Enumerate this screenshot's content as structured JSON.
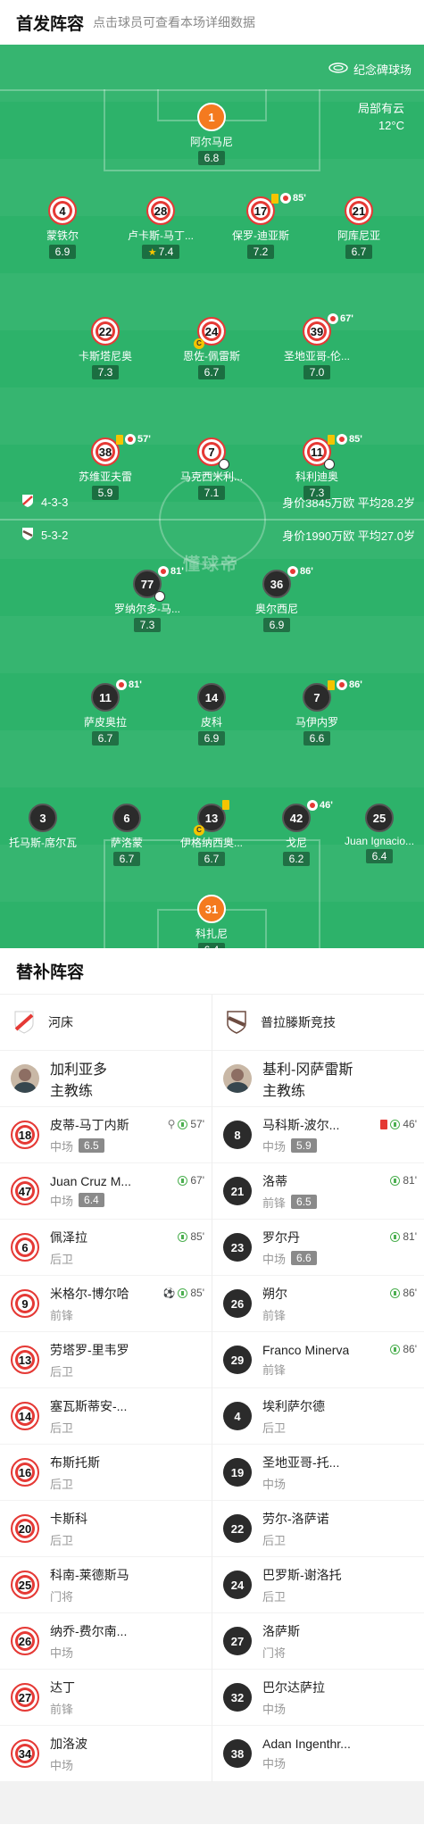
{
  "header": {
    "title": "首发阵容",
    "subtitle": "点击球员可查看本场详细数据"
  },
  "pitch": {
    "venue": "纪念碑球场",
    "weather_line1": "局部有云",
    "weather_line2": "12°C",
    "watermark": "懂球帝",
    "home_formation": "4-3-3",
    "home_value": "身价3845万欧 平均28.2岁",
    "away_formation": "5-3-2",
    "away_value": "身价1990万欧 平均27.0岁"
  },
  "home_players": [
    {
      "num": "1",
      "name": "阿尔马尼",
      "rating": "6.8",
      "gk": true
    },
    {
      "num": "4",
      "name": "蒙铁尔",
      "rating": "6.9"
    },
    {
      "num": "28",
      "name": "卢卡斯-马丁...",
      "rating": "7.4",
      "star": true
    },
    {
      "num": "17",
      "name": "保罗-迪亚斯",
      "rating": "7.2",
      "sub_min": "85'",
      "yellow": true
    },
    {
      "num": "21",
      "name": "阿库尼亚",
      "rating": "6.7"
    },
    {
      "num": "22",
      "name": "卡斯塔尼奥",
      "rating": "7.3"
    },
    {
      "num": "24",
      "name": "恩佐-佩雷斯",
      "rating": "6.7",
      "captain": true
    },
    {
      "num": "39",
      "name": "圣地亚哥-伦...",
      "rating": "7.0",
      "sub_min": "67'"
    },
    {
      "num": "38",
      "name": "苏维亚夫雷",
      "rating": "5.9",
      "sub_min": "57'",
      "yellow": true
    },
    {
      "num": "7",
      "name": "马克西米利...",
      "rating": "7.1",
      "goal": true
    },
    {
      "num": "11",
      "name": "科利迪奥",
      "rating": "7.3",
      "sub_min": "85'",
      "yellow": true,
      "goal": true
    }
  ],
  "away_players": [
    {
      "num": "77",
      "name": "罗纳尔多-马...",
      "rating": "7.3",
      "sub_min": "81'",
      "goal": true
    },
    {
      "num": "36",
      "name": "奥尔西尼",
      "rating": "6.9",
      "sub_min": "86'"
    },
    {
      "num": "11",
      "name": "萨皮奥拉",
      "rating": "6.7",
      "sub_min": "81'"
    },
    {
      "num": "14",
      "name": "皮科",
      "rating": "6.9"
    },
    {
      "num": "7",
      "name": "马伊内罗",
      "rating": "6.6",
      "sub_min": "86'",
      "yellow": true
    },
    {
      "num": "3",
      "name": "托马斯-席尔瓦",
      "rating": ""
    },
    {
      "num": "6",
      "name": "萨洛蒙",
      "rating": "6.7"
    },
    {
      "num": "13",
      "name": "伊格纳西奥...",
      "rating": "6.7",
      "captain": true,
      "yellow": true
    },
    {
      "num": "42",
      "name": "戈尼",
      "rating": "6.2",
      "sub_min": "46'"
    },
    {
      "num": "25",
      "name": "Juan Ignacio...",
      "rating": "6.4"
    },
    {
      "num": "31",
      "name": "科扎尼",
      "rating": "6.4",
      "gk": true
    }
  ],
  "subs": {
    "title": "替补阵容",
    "home_team": "河床",
    "away_team": "普拉滕斯竞技",
    "home_coach": {
      "name": "加利亚多",
      "role": "主教练"
    },
    "away_coach": {
      "name": "基利-冈萨雷斯",
      "role": "主教练"
    },
    "home": [
      {
        "num": "18",
        "name": "皮蒂-马丁内斯",
        "pos": "中场",
        "rating": "6.5",
        "ev": "57'",
        "assist": true
      },
      {
        "num": "47",
        "name": "Juan Cruz M...",
        "pos": "中场",
        "rating": "6.4",
        "ev": "67'"
      },
      {
        "num": "6",
        "name": "佩泽拉",
        "pos": "后卫",
        "rating": "",
        "ev": "85'"
      },
      {
        "num": "9",
        "name": "米格尔-博尔哈",
        "pos": "前锋",
        "rating": "",
        "ev": "85'",
        "goal": true
      },
      {
        "num": "13",
        "name": "劳塔罗-里韦罗",
        "pos": "后卫",
        "rating": "",
        "ev": ""
      },
      {
        "num": "14",
        "name": "塞瓦斯蒂安-...",
        "pos": "后卫",
        "rating": "",
        "ev": ""
      },
      {
        "num": "16",
        "name": "布斯托斯",
        "pos": "后卫",
        "rating": "",
        "ev": ""
      },
      {
        "num": "20",
        "name": "卡斯科",
        "pos": "后卫",
        "rating": "",
        "ev": ""
      },
      {
        "num": "25",
        "name": "科南-莱德斯马",
        "pos": "门将",
        "rating": "",
        "ev": ""
      },
      {
        "num": "26",
        "name": "纳乔-费尔南...",
        "pos": "中场",
        "rating": "",
        "ev": ""
      },
      {
        "num": "27",
        "name": "达丁",
        "pos": "前锋",
        "rating": "",
        "ev": ""
      },
      {
        "num": "34",
        "name": "加洛波",
        "pos": "中场",
        "rating": "",
        "ev": ""
      }
    ],
    "away": [
      {
        "num": "8",
        "name": "马科斯-波尔...",
        "pos": "中场",
        "rating": "5.9",
        "ev": "46'",
        "red": true
      },
      {
        "num": "21",
        "name": "洛蒂",
        "pos": "前锋",
        "rating": "6.5",
        "ev": "81'"
      },
      {
        "num": "23",
        "name": "罗尔丹",
        "pos": "中场",
        "rating": "6.6",
        "ev": "81'"
      },
      {
        "num": "26",
        "name": "朔尔",
        "pos": "前锋",
        "rating": "",
        "ev": "86'"
      },
      {
        "num": "29",
        "name": "Franco Minerva",
        "pos": "前锋",
        "rating": "",
        "ev": "86'"
      },
      {
        "num": "4",
        "name": "埃利萨尔德",
        "pos": "后卫",
        "rating": "",
        "ev": ""
      },
      {
        "num": "19",
        "name": "圣地亚哥-托...",
        "pos": "中场",
        "rating": "",
        "ev": ""
      },
      {
        "num": "22",
        "name": "劳尔-洛萨诺",
        "pos": "后卫",
        "rating": "",
        "ev": ""
      },
      {
        "num": "24",
        "name": "巴罗斯-谢洛托",
        "pos": "后卫",
        "rating": "",
        "ev": ""
      },
      {
        "num": "27",
        "name": "洛萨斯",
        "pos": "门将",
        "rating": "",
        "ev": ""
      },
      {
        "num": "32",
        "name": "巴尔达萨拉",
        "pos": "中场",
        "rating": "",
        "ev": ""
      },
      {
        "num": "38",
        "name": "Adan Ingenthr...",
        "pos": "中场",
        "rating": "",
        "ev": ""
      }
    ]
  }
}
